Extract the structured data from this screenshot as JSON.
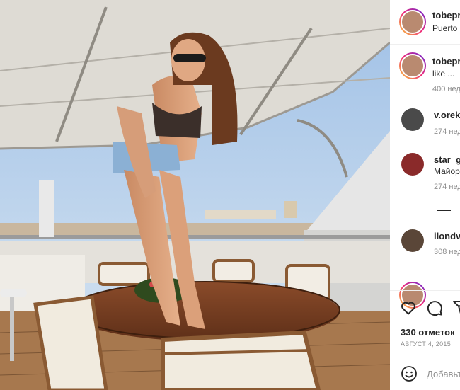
{
  "post": {
    "header": {
      "username": "tobepr",
      "location": "Puerto P"
    },
    "caption": {
      "username": "tobepr",
      "text": "like ...",
      "time": "400 нед"
    },
    "comments": [
      {
        "username": "v.orekh",
        "text": "",
        "time": "274 нед"
      },
      {
        "username": "star_ga",
        "text": "Майор",
        "time": "274 нед"
      },
      {
        "username": "ilondv",
        "text": "",
        "time": "308 нед"
      }
    ],
    "likes": "330 отметок",
    "date": "Август 4, 2015",
    "add_comment_placeholder": "Добавьте"
  },
  "colors": {
    "text": "#262626",
    "meta": "#8e8e8e",
    "divider": "#efefef"
  }
}
